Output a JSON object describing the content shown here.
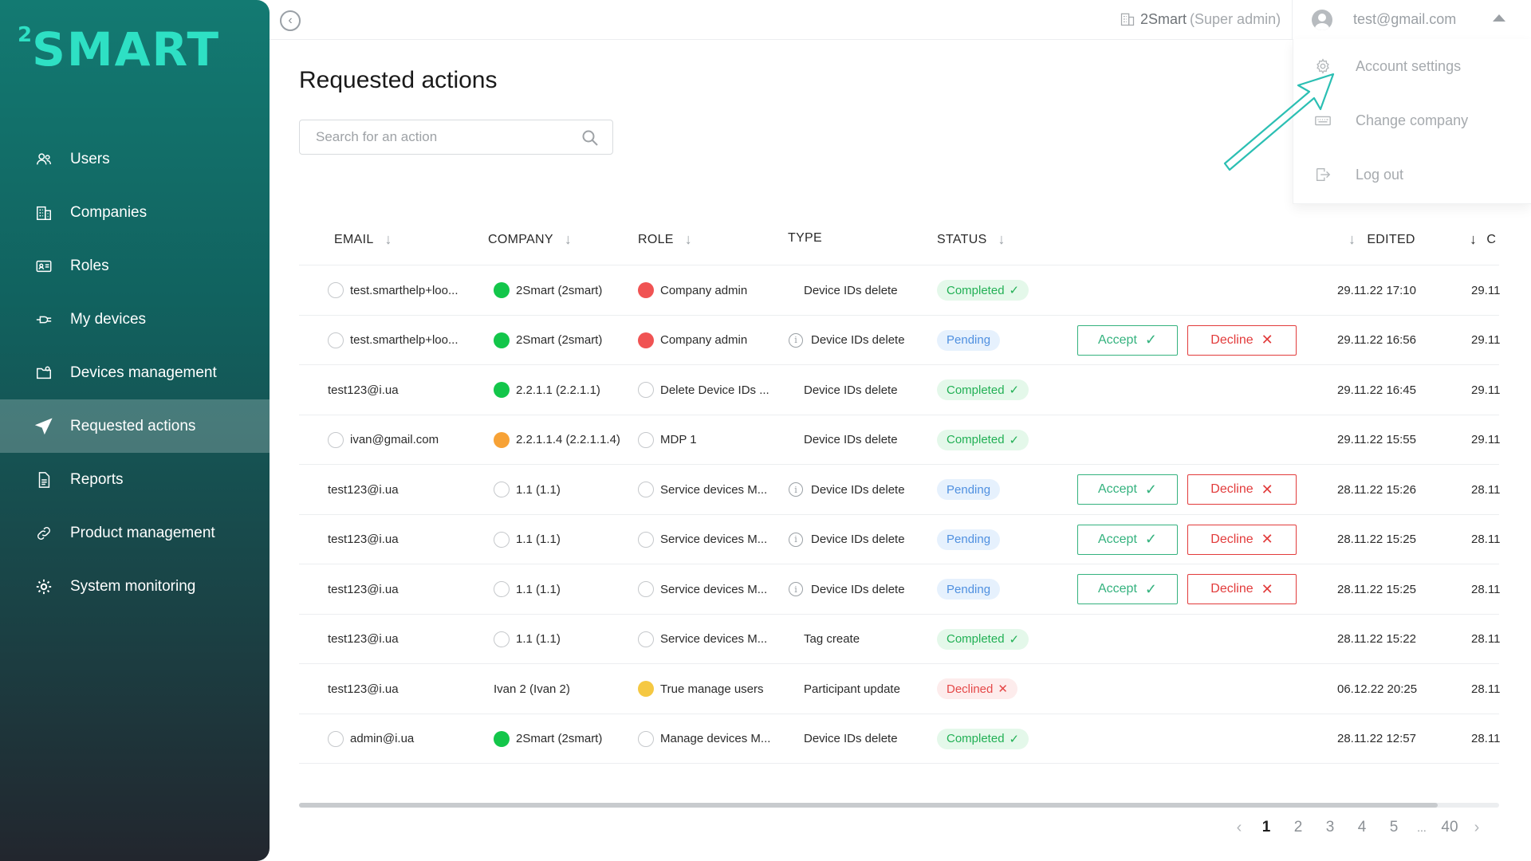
{
  "app": {
    "logo_text": "SMART",
    "logo_sup": "2"
  },
  "sidebar": {
    "items": [
      {
        "label": "Users",
        "icon": "users-icon"
      },
      {
        "label": "Companies",
        "icon": "building-icon"
      },
      {
        "label": "Roles",
        "icon": "id-card-icon"
      },
      {
        "label": "My devices",
        "icon": "plug-icon"
      },
      {
        "label": "Devices management",
        "icon": "folder-gear-icon"
      },
      {
        "label": "Requested actions",
        "icon": "paper-plane-icon",
        "active": true
      },
      {
        "label": "Reports",
        "icon": "document-icon"
      },
      {
        "label": "Product management",
        "icon": "link-icon"
      },
      {
        "label": "System monitoring",
        "icon": "gear-icon"
      }
    ]
  },
  "header": {
    "company_name": "2Smart",
    "company_role": "(Super admin)",
    "user_email": "test@gmail.com"
  },
  "user_menu": {
    "items": [
      {
        "label": "Account settings",
        "icon": "gear-icon"
      },
      {
        "label": "Change company",
        "icon": "keyboard-icon"
      },
      {
        "label": "Log out",
        "icon": "logout-icon"
      }
    ]
  },
  "main": {
    "title": "Requested actions",
    "search": {
      "placeholder": "Search for an action",
      "value": ""
    },
    "columns": {
      "email": "EMAIL",
      "company": "COMPANY",
      "role": "ROLE",
      "type": "TYPE",
      "status": "STATUS",
      "edited": "EDITED",
      "created_partial": "C"
    },
    "accept_label": "Accept",
    "decline_label": "Decline",
    "rows": [
      {
        "email": "test.smarthelp+loo...",
        "email_dot": "empty",
        "company": "2Smart (2smart)",
        "company_dot": "green",
        "role": "Company admin",
        "role_dot": "red",
        "type": "Device IDs delete",
        "type_info": false,
        "status": "Completed",
        "status_kind": "completed",
        "actions": false,
        "edited": "29.11.22 17:10",
        "created": "29.11"
      },
      {
        "email": "test.smarthelp+loo...",
        "email_dot": "empty",
        "company": "2Smart (2smart)",
        "company_dot": "green",
        "role": "Company admin",
        "role_dot": "red",
        "type": "Device IDs delete",
        "type_info": true,
        "status": "Pending",
        "status_kind": "pending",
        "actions": true,
        "edited": "29.11.22 16:56",
        "created": "29.11"
      },
      {
        "email": "test123@i.ua",
        "email_dot": "",
        "company": "2.2.1.1 (2.2.1.1)",
        "company_dot": "green",
        "role": "Delete Device IDs ...",
        "role_dot": "empty",
        "type": "Device IDs delete",
        "type_info": false,
        "status": "Completed",
        "status_kind": "completed",
        "actions": false,
        "edited": "29.11.22 16:45",
        "created": "29.11"
      },
      {
        "email": "ivan@gmail.com",
        "email_dot": "empty",
        "company": "2.2.1.1.4 (2.2.1.1.4)",
        "company_dot": "orange",
        "role": "MDP 1",
        "role_dot": "empty",
        "type": "Device IDs delete",
        "type_info": false,
        "status": "Completed",
        "status_kind": "completed",
        "actions": false,
        "edited": "29.11.22 15:55",
        "created": "29.11"
      },
      {
        "email": "test123@i.ua",
        "email_dot": "",
        "company": "1.1 (1.1)",
        "company_dot": "empty",
        "role": "Service devices M...",
        "role_dot": "empty",
        "type": "Device IDs delete",
        "type_info": true,
        "status": "Pending",
        "status_kind": "pending",
        "actions": true,
        "edited": "28.11.22 15:26",
        "created": "28.11"
      },
      {
        "email": "test123@i.ua",
        "email_dot": "",
        "company": "1.1 (1.1)",
        "company_dot": "empty",
        "role": "Service devices M...",
        "role_dot": "empty",
        "type": "Device IDs delete",
        "type_info": true,
        "status": "Pending",
        "status_kind": "pending",
        "actions": true,
        "edited": "28.11.22 15:25",
        "created": "28.11"
      },
      {
        "email": "test123@i.ua",
        "email_dot": "",
        "company": "1.1 (1.1)",
        "company_dot": "empty",
        "role": "Service devices M...",
        "role_dot": "empty",
        "type": "Device IDs delete",
        "type_info": true,
        "status": "Pending",
        "status_kind": "pending",
        "actions": true,
        "edited": "28.11.22 15:25",
        "created": "28.11"
      },
      {
        "email": "test123@i.ua",
        "email_dot": "",
        "company": "1.1 (1.1)",
        "company_dot": "empty",
        "role": "Service devices M...",
        "role_dot": "empty",
        "type": "Tag create",
        "type_info": false,
        "status": "Completed",
        "status_kind": "completed",
        "actions": false,
        "edited": "28.11.22 15:22",
        "created": "28.11"
      },
      {
        "email": "test123@i.ua",
        "email_dot": "",
        "company": "Ivan 2 (Ivan 2)",
        "company_dot": "",
        "role": "True manage users",
        "role_dot": "yellow",
        "type": "Participant update",
        "type_info": false,
        "status": "Declined",
        "status_kind": "declined",
        "actions": false,
        "edited": "06.12.22 20:25",
        "created": "28.11"
      },
      {
        "email": "admin@i.ua",
        "email_dot": "empty",
        "company": "2Smart (2smart)",
        "company_dot": "green",
        "role": "Manage devices M...",
        "role_dot": "empty",
        "type": "Device IDs delete",
        "type_info": false,
        "status": "Completed",
        "status_kind": "completed",
        "actions": false,
        "edited": "28.11.22 12:57",
        "created": "28.11"
      }
    ]
  },
  "pagination": {
    "pages": [
      "1",
      "2",
      "3",
      "4",
      "5"
    ],
    "ellipsis": "...",
    "last_page": "40",
    "current": "1",
    "prev_icon": "chevron-left-icon",
    "next_icon": "chevron-right-icon"
  },
  "colors": {
    "accent": "#2ee0c4",
    "accept": "#34b27e",
    "decline": "#e23b3b",
    "annotation_arrow": "#2bbfb3"
  }
}
